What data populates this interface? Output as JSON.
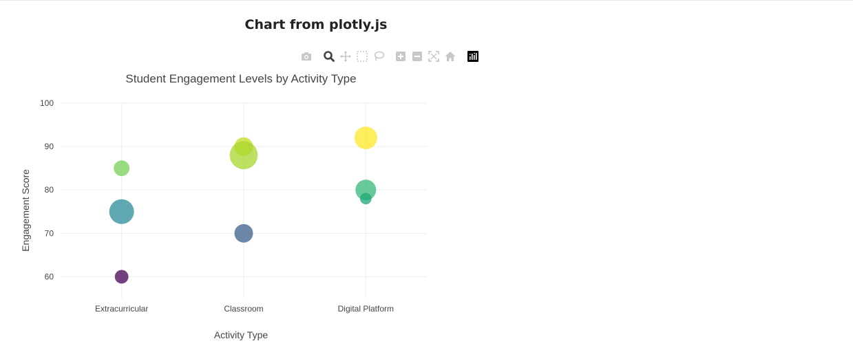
{
  "page": {
    "title": "Chart from plotly.js"
  },
  "modebar": {
    "buttons": [
      {
        "name": "camera-icon",
        "active": false
      },
      {
        "name": "zoom-icon",
        "active": true
      },
      {
        "name": "pan-icon",
        "active": false
      },
      {
        "name": "box-select-icon",
        "active": false
      },
      {
        "name": "lasso-select-icon",
        "active": false
      },
      {
        "name": "zoom-in-icon",
        "active": false
      },
      {
        "name": "zoom-out-icon",
        "active": false
      },
      {
        "name": "autoscale-icon",
        "active": false
      },
      {
        "name": "reset-axes-icon",
        "active": false
      },
      {
        "name": "plotly-logo-icon",
        "active": false
      }
    ],
    "colors": {
      "inactive": "#c8c8c8",
      "active": "#444444",
      "logo": "#000000"
    }
  },
  "chart_data": {
    "type": "scatter",
    "title": "Student Engagement Levels by Activity Type",
    "xlabel": "Activity Type",
    "ylabel": "Engagement Score",
    "categories": [
      "Extracurricular",
      "Classroom",
      "Digital Platform"
    ],
    "ylim": [
      55,
      100
    ],
    "yticks": [
      60,
      70,
      80,
      90,
      100
    ],
    "grid": true,
    "marker_size": "bubble",
    "points": [
      {
        "x": "Extracurricular",
        "y": 60,
        "size": 0.33,
        "color": "#440154"
      },
      {
        "x": "Classroom",
        "y": 70,
        "size": 0.45,
        "color": "#3b5f8a"
      },
      {
        "x": "Extracurricular",
        "y": 75,
        "size": 0.6,
        "color": "#2c8c98"
      },
      {
        "x": "Digital Platform",
        "y": 80,
        "size": 0.5,
        "color": "#35b779"
      },
      {
        "x": "Digital Platform",
        "y": 78,
        "size": 0.28,
        "color": "#1fa87a"
      },
      {
        "x": "Extracurricular",
        "y": 85,
        "size": 0.38,
        "color": "#74d055"
      },
      {
        "x": "Classroom",
        "y": 90,
        "size": 0.45,
        "color": "#c2df23"
      },
      {
        "x": "Classroom",
        "y": 88,
        "size": 0.68,
        "color": "#a8d62c"
      },
      {
        "x": "Digital Platform",
        "y": 92,
        "size": 0.55,
        "color": "#fde725"
      }
    ]
  }
}
